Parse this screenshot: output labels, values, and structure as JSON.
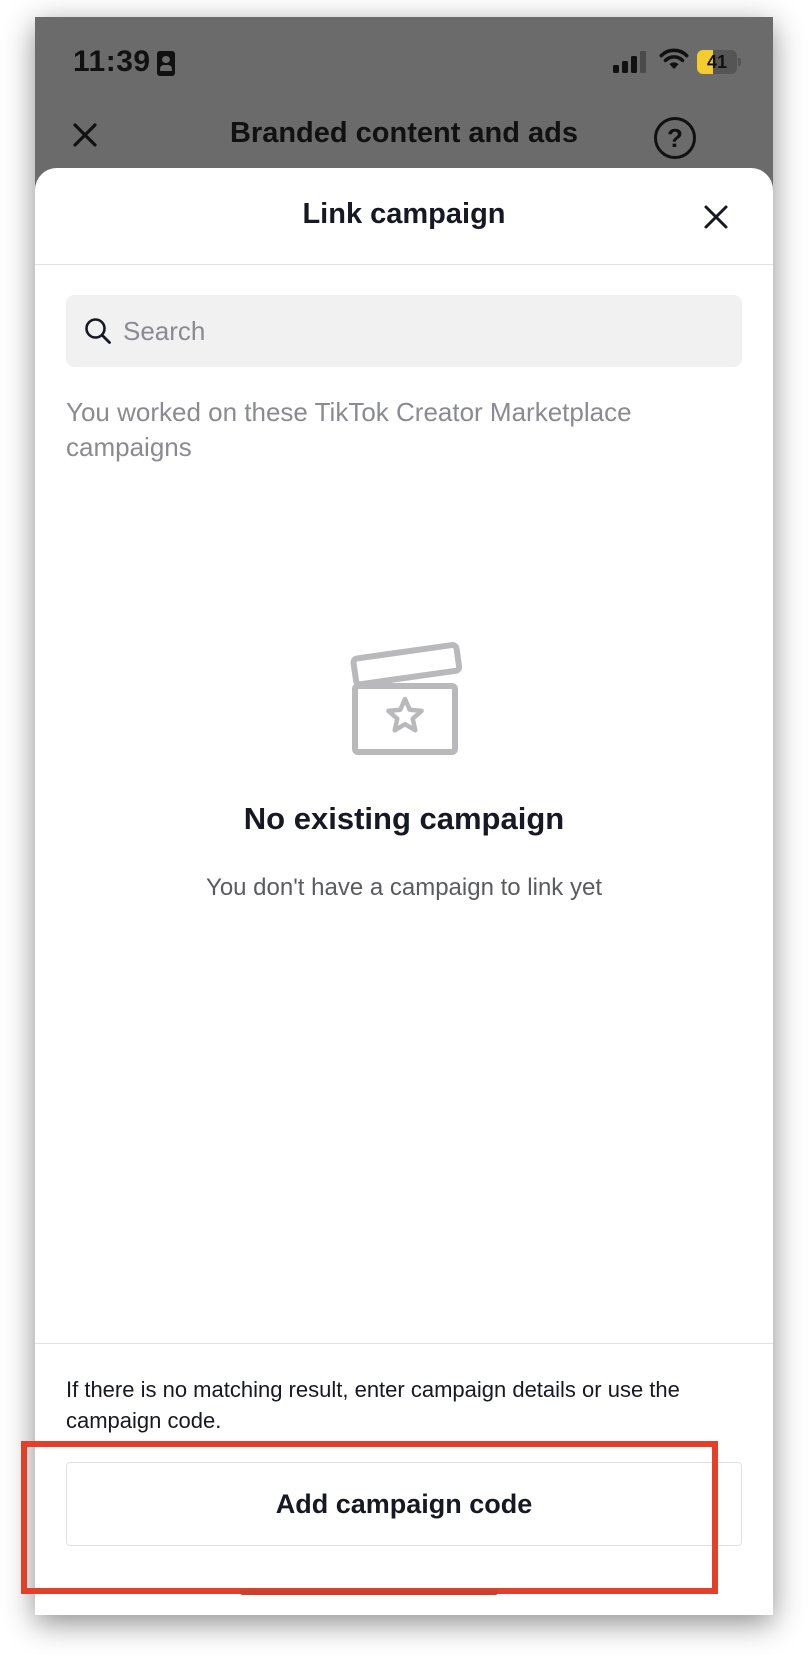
{
  "status_bar": {
    "time": "11:39",
    "battery": "41",
    "battery_level": 0.41,
    "icons": [
      "id-card-icon",
      "cellular-signal-icon",
      "wifi-icon",
      "battery-charging-icon"
    ]
  },
  "nav": {
    "title": "Branded content and ads",
    "left_icon": "close-icon",
    "right_icon": "help-icon",
    "help_glyph": "?"
  },
  "sheet": {
    "title": "Link campaign",
    "close_icon": "close-icon",
    "search": {
      "placeholder": "Search",
      "value": "",
      "icon": "search-icon"
    },
    "caption": "You worked on these TikTok Creator Marketplace campaigns",
    "empty_state": {
      "icon": "clapperboard-star-icon",
      "title": "No existing campaign",
      "subtitle": "You don't have a campaign to link yet"
    },
    "footer": {
      "text": "If there is no matching result, enter campaign details or use the campaign code.",
      "button_label": "Add campaign code"
    }
  },
  "colors": {
    "overlay_gray": "#6b6b6b",
    "highlight_red": "#e2402a",
    "battery_yellow": "#f4cc2e",
    "text_primary": "#161823",
    "text_secondary": "#8a8b91"
  }
}
